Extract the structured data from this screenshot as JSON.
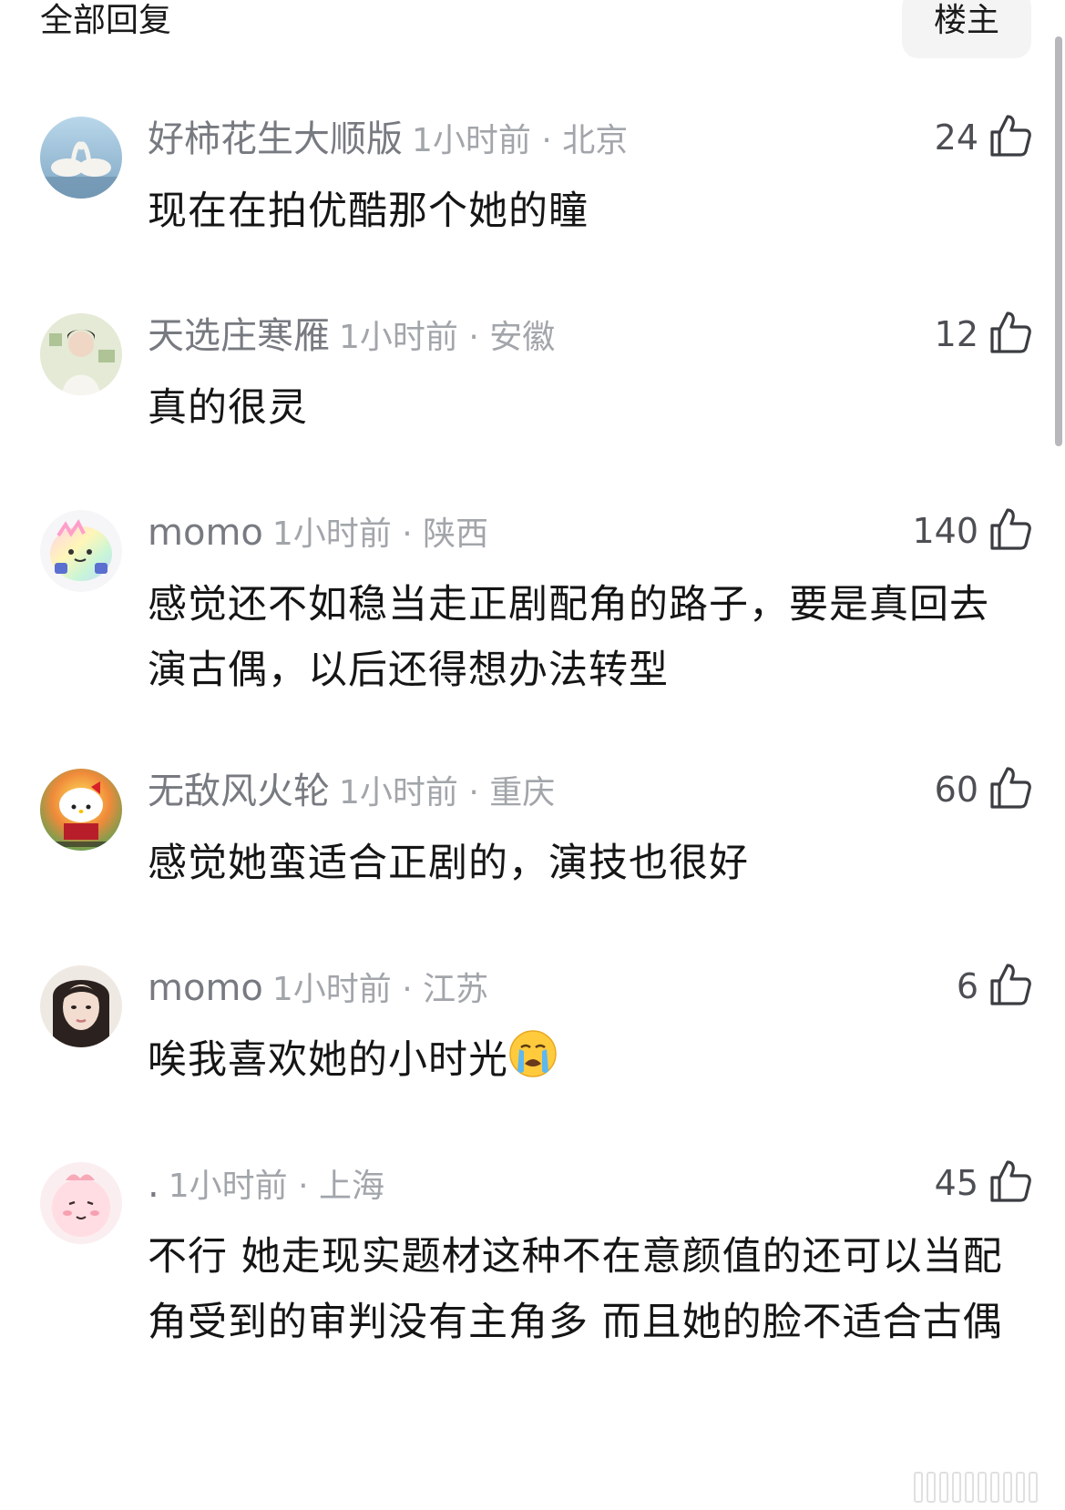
{
  "header": {
    "title": "全部回复",
    "filter_label": "楼主"
  },
  "comments": [
    {
      "username": "好柿花生大顺版",
      "time_location": "1小时前 · 北京",
      "likes": "24",
      "text": "现在在拍优酷那个她的瞳",
      "avatar": "swans-avatar"
    },
    {
      "username": "天选庄寒雁",
      "time_location": "1小时前 · 安徽",
      "likes": "12",
      "text": "真的很灵",
      "avatar": "girl-portrait-avatar"
    },
    {
      "username": "momo",
      "time_location": "1小时前 · 陕西",
      "likes": "140",
      "text": "感觉还不如稳当走正剧配角的路子，要是真回去演古偶，以后还得想办法转型",
      "avatar": "cartoon-blob-avatar"
    },
    {
      "username": "无敌风火轮",
      "time_location": "1小时前 · 重庆",
      "likes": "60",
      "text": "感觉她蛮适合正剧的，演技也很好",
      "avatar": "hello-kitty-avatar"
    },
    {
      "username": "momo",
      "time_location": "1小时前 · 江苏",
      "likes": "6",
      "text": "唉我喜欢她的小时光",
      "emoji": "crying-face-emoji",
      "avatar": "woman-portrait-avatar"
    },
    {
      "username": ".",
      "time_location": "1小时前 · 上海",
      "likes": "45",
      "text": "不行 她走现实题材这种不在意颜值的还可以当配角受到的审判没有主角多 而且她的脸不适合古偶",
      "avatar": "pink-cartoon-avatar"
    }
  ],
  "icons": {
    "like": "thumbs-up-icon"
  },
  "colors": {
    "username": "#777a80",
    "meta": "#a2a5aa",
    "text": "#151515",
    "filter_bg": "#f4f4f5"
  }
}
